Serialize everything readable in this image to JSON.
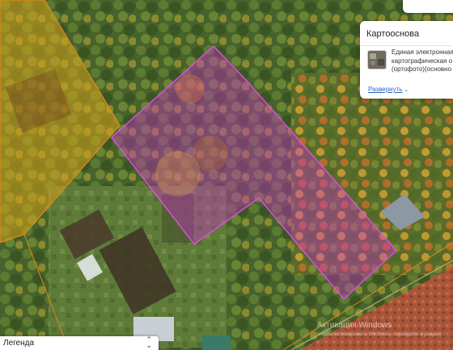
{
  "panel": {
    "title": "Картооснова",
    "description_lines": [
      "Единая электронная",
      "картографическая о",
      "(ортофото)(основно"
    ],
    "expand_label": "Развернуть",
    "expand_icon": "chevron-down-icon"
  },
  "legend": {
    "label": "Легенда",
    "icon": "select-arrows-icon"
  },
  "watermark": {
    "line1": "Активация Windows",
    "line2": "Чтобы активировать Windows, перейдите в раздел"
  },
  "colors": {
    "parcel_highlight": "#d42bd6",
    "parcel_outline": "#e050e0",
    "neighbor_parcel_fill": "#d9a41c",
    "neighbor_parcel_outline": "#e08a1a",
    "link": "#2c64c9"
  }
}
